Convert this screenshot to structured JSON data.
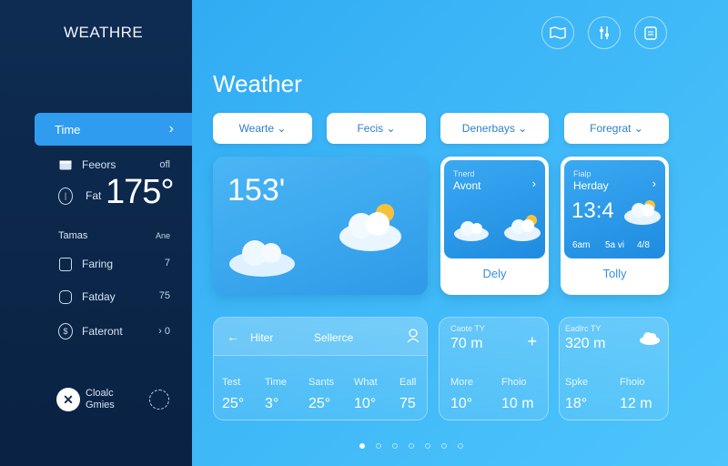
{
  "app": {
    "brand": "WEATHRE"
  },
  "sidebar": {
    "active_item": {
      "label": "Time",
      "chevron": "›"
    },
    "items": [
      {
        "label": "Feeors",
        "value": "ofl",
        "icon": "calendar-icon"
      },
      {
        "label": "Fat",
        "value": "",
        "icon": "clock-icon"
      },
      {
        "label": "Tamas",
        "value": "Ane",
        "icon": ""
      },
      {
        "label": "Faring",
        "value": "7",
        "icon": "document-icon"
      },
      {
        "label": "Fatday",
        "value": "75",
        "icon": "camera-icon"
      },
      {
        "label": "Fateront",
        "value": "› 0",
        "icon": "dollar-icon"
      }
    ],
    "big_temp": "175°",
    "footer": {
      "line1": "Cloalc",
      "line2": "Gmies"
    }
  },
  "header": {
    "icons": [
      "map-icon",
      "controls-icon",
      "clipboard-icon"
    ]
  },
  "main": {
    "title": "Weather",
    "filters": [
      {
        "label": "Wearte ⌄"
      },
      {
        "label": "Fecis ⌄"
      },
      {
        "label": "Denerbays ⌄"
      },
      {
        "label": "Foregrat ⌄"
      }
    ],
    "main_card": {
      "temp": "153'"
    },
    "card2": {
      "small": "Tnerd",
      "title": "Avont",
      "footer": "Dely"
    },
    "card3": {
      "small": "Fialp",
      "title": "Herday",
      "time": "13:4",
      "stats": [
        "6am",
        "5a vi",
        "4/8"
      ],
      "footer": "Tolly"
    },
    "bottom_left": {
      "back": "←",
      "tab1": "Hiter",
      "tab2": "Sellerce",
      "headers": [
        "Test",
        "Time",
        "Sants",
        "What",
        "Eall"
      ],
      "values": [
        "25°",
        "3°",
        "25°",
        "10°",
        "75"
      ]
    },
    "bottom_mid": {
      "small": "Caote TY",
      "big": "70 m",
      "plus": "+",
      "headers": [
        "More",
        "Fhoio"
      ],
      "values": [
        "10°",
        "10 m"
      ]
    },
    "bottom_right": {
      "small": "Eadlrc TY",
      "big": "320 m",
      "headers": [
        "Spke",
        "Fhoio"
      ],
      "values": [
        "18°",
        "12 m"
      ]
    }
  },
  "pagination": {
    "count": 6,
    "active": 0
  },
  "colors": {
    "accent": "#2f9cf0",
    "sidebar": "#0e2c52",
    "background": "#3ab4f6"
  }
}
